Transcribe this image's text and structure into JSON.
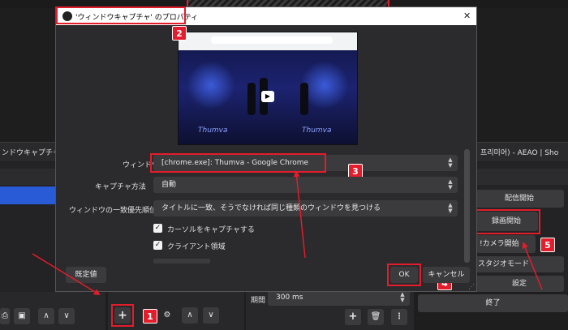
{
  "left_panel": {
    "source_label": "ンドウキャプチャ"
  },
  "right_panel": {
    "title_text": "프리미어) - AEAO | Sho",
    "stream_button": "配信開始",
    "record_button": "録画開始",
    "virtual_camera_button": "!カメラ開始",
    "studio_mode_button": "スタジオモード",
    "settings_button": "設定",
    "exit_button": "終了"
  },
  "transition": {
    "duration_label": "期間",
    "duration_value": "300 ms"
  },
  "dialog": {
    "title": "'ウィンドウキャプチャ' のプロパティ",
    "close_glyph": "✕",
    "preview_caption": "Thumva",
    "window_label": "ウィンドウ",
    "window_value": "[chrome.exe]: Thumva - Google Chrome",
    "capture_method_label": "キャプチャ方法",
    "capture_method_value": "自動",
    "priority_label": "ウィンドウの一致優先順位",
    "priority_value": "タイトルに一致、そうでなければ同じ種類のウィンドウを見つける",
    "capture_cursor_label": "カーソルをキャプチャする",
    "client_area_label": "クライアント領域",
    "defaults_button": "既定値",
    "ok_button": "OK",
    "cancel_button": "キャンセル"
  },
  "bottom_toolbar": {
    "add_glyph": "+",
    "up_glyph": "∧",
    "down_glyph": "∨"
  },
  "badges": [
    "1",
    "2",
    "3",
    "4",
    "5"
  ],
  "colors": {
    "annotation_red": "#e31d2b",
    "dialog_bg": "#2b2a2d",
    "selection_blue": "#2a5bd7"
  }
}
